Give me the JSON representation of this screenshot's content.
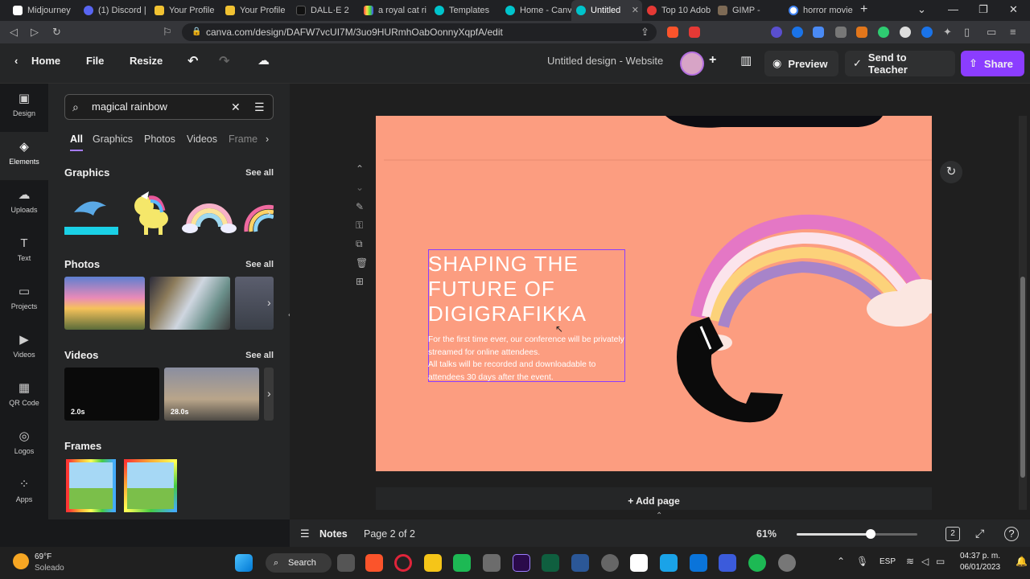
{
  "browser": {
    "tabs": [
      {
        "label": "Midjourney",
        "color": "#ffffff"
      },
      {
        "label": "(1) Discord |",
        "color": "#5865f2"
      },
      {
        "label": "Your Profile",
        "color": "#f1c232"
      },
      {
        "label": "Your Profile",
        "color": "#f1c232"
      },
      {
        "label": "DALL·E 2",
        "color": "#111111"
      },
      {
        "label": "a royal cat ri",
        "color": "#8bc34a"
      },
      {
        "label": "Templates",
        "color": "#00c4cc"
      },
      {
        "label": "Home - Canv",
        "color": "#00c4cc"
      },
      {
        "label": "Untitled",
        "color": "#00c4cc"
      },
      {
        "label": "Top 10 Adob",
        "color": "#e53935"
      },
      {
        "label": "GIMP - ",
        "color": "#7d6a55"
      },
      {
        "label": "horror movie",
        "color": "#4285f4"
      }
    ],
    "url": "canva.com/design/DAFW7vcUI7M/3uo9HURmhOabOonnyXqpfA/edit"
  },
  "header": {
    "home": "Home",
    "file": "File",
    "resize": "Resize",
    "design_title": "Untitled design - Website",
    "preview": "Preview",
    "send_to_teacher": "Send to Teacher",
    "share": "Share"
  },
  "rail": [
    {
      "label": "Design",
      "icon": "design-icon",
      "glyph": "▣"
    },
    {
      "label": "Elements",
      "icon": "elements-icon",
      "glyph": "◈"
    },
    {
      "label": "Uploads",
      "icon": "uploads-icon",
      "glyph": "☁"
    },
    {
      "label": "Text",
      "icon": "text-icon",
      "glyph": "T"
    },
    {
      "label": "Projects",
      "icon": "projects-icon",
      "glyph": "▭"
    },
    {
      "label": "Videos",
      "icon": "videos-icon",
      "glyph": "▶"
    },
    {
      "label": "QR Code",
      "icon": "qr-code-icon",
      "glyph": "▦"
    },
    {
      "label": "Logos",
      "icon": "logos-icon",
      "glyph": "◎"
    },
    {
      "label": "Apps",
      "icon": "apps-icon",
      "glyph": "⁘"
    }
  ],
  "panel": {
    "search_value": "magical rainbow",
    "filters": [
      "All",
      "Graphics",
      "Photos",
      "Videos",
      "Frame"
    ],
    "graphics_title": "Graphics",
    "photos_title": "Photos",
    "videos_title": "Videos",
    "frames_title": "Frames",
    "see_all": "See all",
    "video_durations": [
      "2.0s",
      "28.0s"
    ]
  },
  "canvas": {
    "title": "SHAPING THE\nFUTURE OF\nDIGIGRAFIKKA",
    "body": "For the first time ever, our conference will be privately streamed for online attendees.\nAll talks will be recorded and downloadable to attendees 30 days after the event.",
    "add_page": "+ Add page",
    "background": "#fc9d80"
  },
  "footer": {
    "notes": "Notes",
    "page_indicator": "Page 2 of 2",
    "zoom": "61%",
    "zoom_fraction": 0.61,
    "pages_count": "2"
  },
  "taskbar": {
    "weather_temp": "69°F",
    "weather_desc": "Soleado",
    "search": "Search",
    "lang": "ESP",
    "time": "04:37 p. m.",
    "date": "06/01/2023"
  }
}
